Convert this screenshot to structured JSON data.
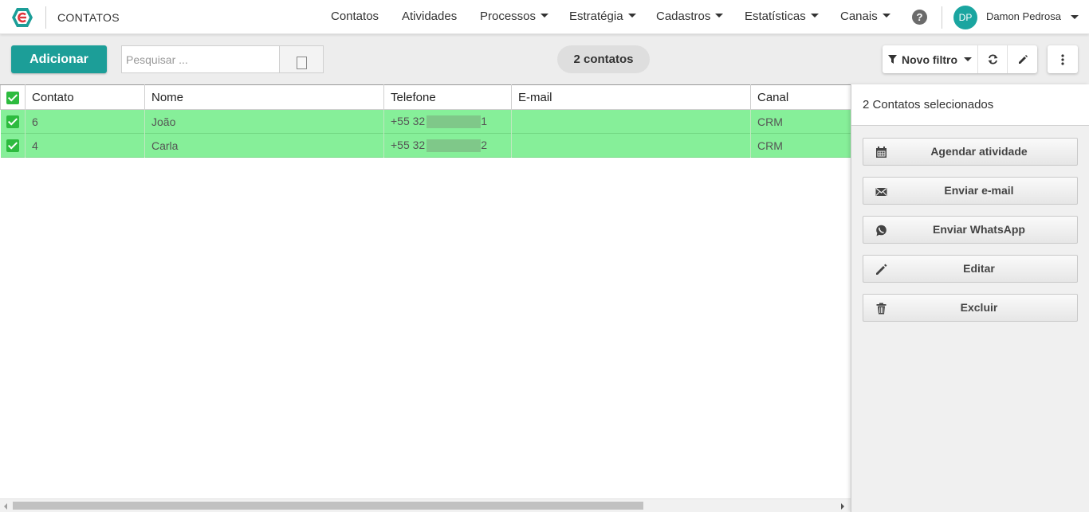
{
  "app": {
    "title": "CONTATOS"
  },
  "nav": {
    "items": [
      {
        "label": "Contatos",
        "dropdown": false
      },
      {
        "label": "Atividades",
        "dropdown": false
      },
      {
        "label": "Processos",
        "dropdown": true
      },
      {
        "label": "Estratégia",
        "dropdown": true
      },
      {
        "label": "Cadastros",
        "dropdown": true
      },
      {
        "label": "Estatísticas",
        "dropdown": true
      },
      {
        "label": "Canais",
        "dropdown": true
      }
    ],
    "help_icon": "?",
    "user": {
      "initials": "DP",
      "name": "Damon Pedrosa"
    }
  },
  "toolbar": {
    "add_label": "Adicionar",
    "search_placeholder": "Pesquisar ...",
    "count_label": "2 contatos",
    "filter_label": "Novo filtro"
  },
  "table": {
    "headers": [
      "Contato",
      "Nome",
      "Telefone",
      "E-mail",
      "Canal"
    ],
    "rows": [
      {
        "contato": "6",
        "nome": "João",
        "telefone_prefix": "+55 32",
        "telefone_suffix": "1",
        "email": "",
        "canal": "CRM"
      },
      {
        "contato": "4",
        "nome": "Carla",
        "telefone_prefix": "+55 32",
        "telefone_suffix": "2",
        "email": "",
        "canal": "CRM"
      }
    ]
  },
  "panel": {
    "title": "2 Contatos selecionados",
    "actions": [
      {
        "label": "Agendar atividade",
        "icon": "calendar-icon"
      },
      {
        "label": "Enviar e-mail",
        "icon": "envelope-icon"
      },
      {
        "label": "Enviar WhatsApp",
        "icon": "whatsapp-icon"
      },
      {
        "label": "Editar",
        "icon": "pencil-icon"
      },
      {
        "label": "Excluir",
        "icon": "trash-icon"
      }
    ]
  },
  "colors": {
    "accent": "#1c9e98",
    "selected_row": "#86ef99",
    "checkbox": "#2dbb3f"
  }
}
